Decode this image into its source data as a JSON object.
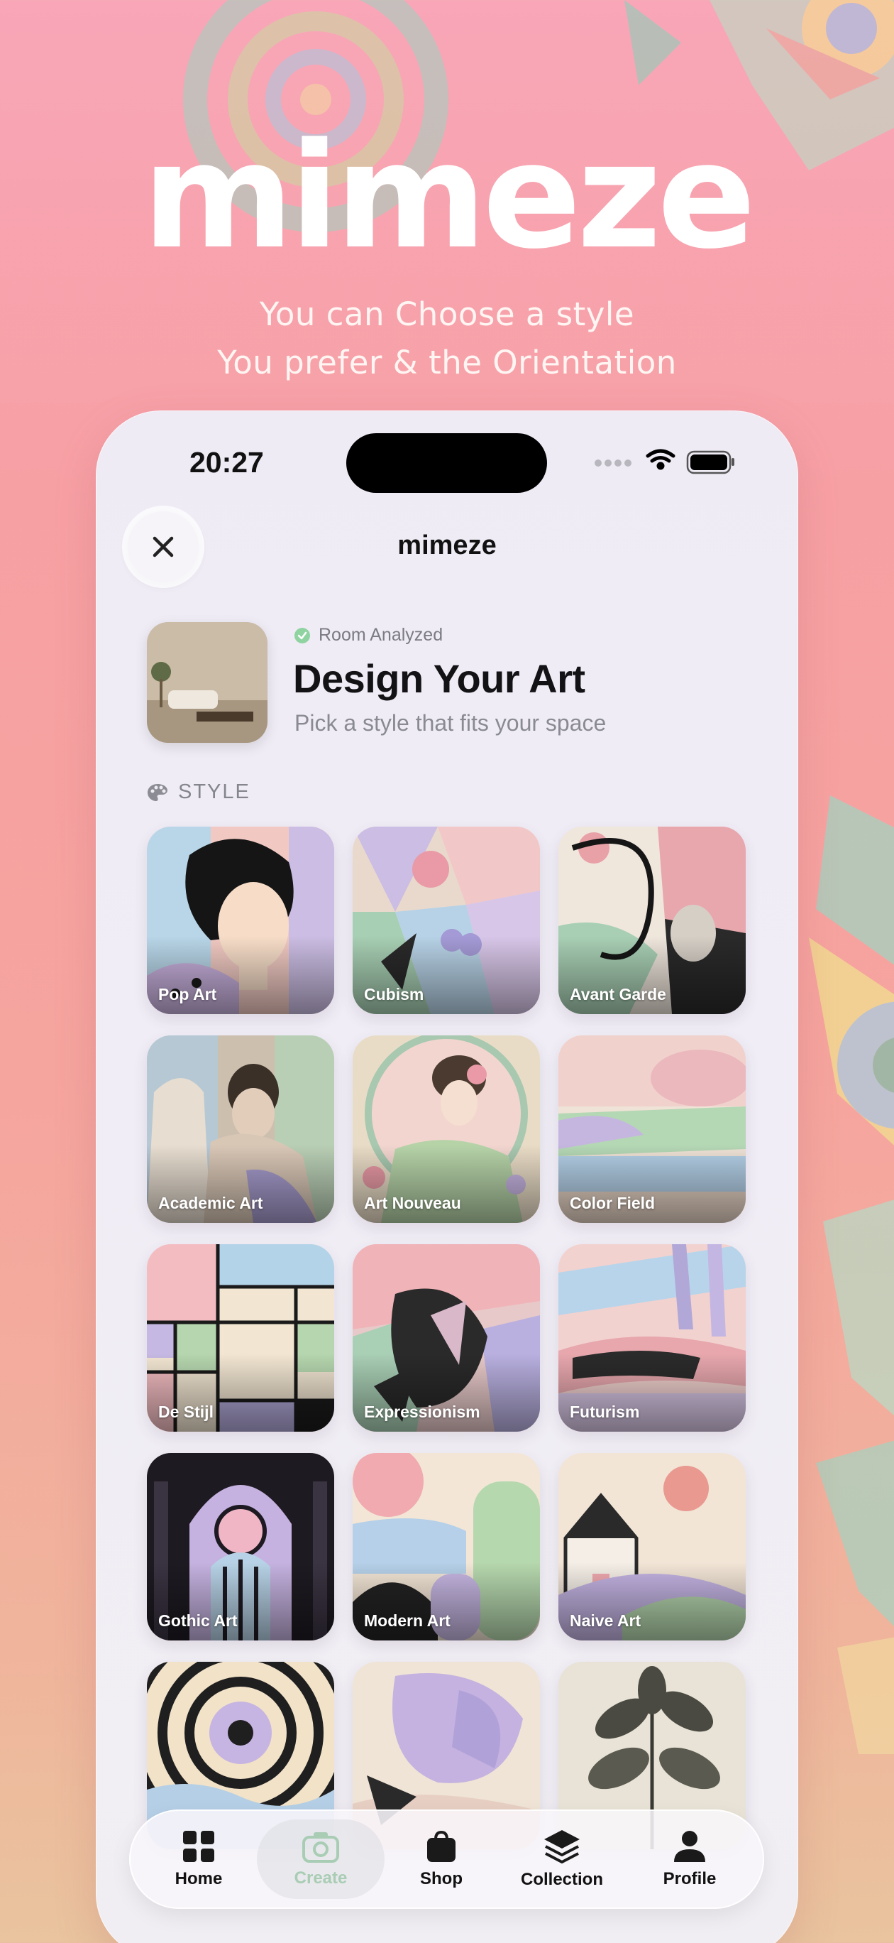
{
  "hero": {
    "title": "mimeze",
    "subtitle_line1": "You can Choose a style",
    "subtitle_line2": "You prefer & the Orientation"
  },
  "status_bar": {
    "time": "20:27",
    "icons": [
      "cellular-dots-icon",
      "wifi-icon",
      "battery-icon"
    ]
  },
  "nav": {
    "title": "mimeze",
    "close_icon": "close-icon"
  },
  "header": {
    "badge_text": "Room Analyzed",
    "badge_color": "#8fd3a1",
    "title": "Design Your Art",
    "subtitle": "Pick a style that fits your space"
  },
  "section": {
    "label": "STYLE",
    "icon": "palette-icon"
  },
  "styles": [
    {
      "label": "Pop Art"
    },
    {
      "label": "Cubism"
    },
    {
      "label": "Avant Garde"
    },
    {
      "label": "Academic Art"
    },
    {
      "label": "Art Nouveau"
    },
    {
      "label": "Color Field"
    },
    {
      "label": "De Stijl"
    },
    {
      "label": "Expressionism"
    },
    {
      "label": "Futurism"
    },
    {
      "label": "Gothic Art"
    },
    {
      "label": "Modern Art"
    },
    {
      "label": "Naive Art"
    },
    {
      "label": ""
    },
    {
      "label": ""
    },
    {
      "label": ""
    }
  ],
  "tabbar": {
    "tabs": [
      {
        "label": "Home",
        "icon": "grid-icon"
      },
      {
        "label": "Create",
        "icon": "camera-icon"
      },
      {
        "label": "Shop",
        "icon": "shopping-bag-icon"
      },
      {
        "label": "Collection",
        "icon": "layers-icon"
      },
      {
        "label": "Profile",
        "icon": "person-icon"
      }
    ],
    "active": "Create",
    "active_color": "#a9cdb4"
  }
}
